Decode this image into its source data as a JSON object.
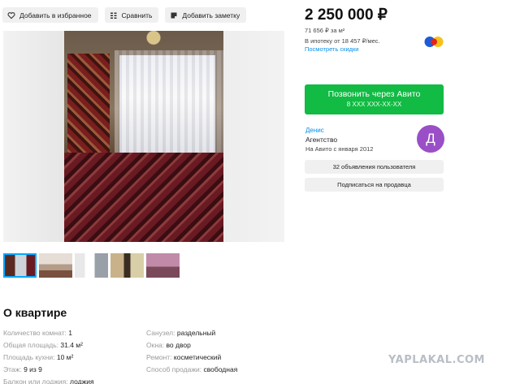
{
  "toolbar": {
    "favorites_label": "Добавить в избранное",
    "compare_label": "Сравнить",
    "note_label": "Добавить заметку",
    "icons": [
      "heart-icon",
      "compare-icon",
      "note-icon"
    ]
  },
  "thumbnails_count": 5,
  "about": {
    "title": "О квартире",
    "left": [
      {
        "key": "Количество комнат:",
        "value": "1"
      },
      {
        "key": "Общая площадь:",
        "value": "31.4 м²"
      },
      {
        "key": "Площадь кухни:",
        "value": "10 м²"
      },
      {
        "key": "Этаж:",
        "value": "9 из 9"
      },
      {
        "key": "Балкон или лоджия:",
        "value": "лоджия"
      }
    ],
    "right": [
      {
        "key": "Санузел:",
        "value": "раздельный"
      },
      {
        "key": "Окна:",
        "value": "во двор"
      },
      {
        "key": "Ремонт:",
        "value": "косметический"
      },
      {
        "key": "Способ продажи:",
        "value": "свободная"
      }
    ]
  },
  "price": {
    "main": "2 250 000 ₽",
    "per_m": "71 656 ₽ за м²",
    "mortgage": "В ипотеку от 18 457 ₽/мес.",
    "discounts_link": "Посмотреть скидки"
  },
  "call": {
    "label": "Позвонить через Авито",
    "phone": "8 XXX XXX-XX-XX"
  },
  "seller": {
    "name": "Денис",
    "type": "Агентство",
    "since": "На Авито с января 2012",
    "avatar_letter": "Д",
    "avatar_color": "#9a4fc7",
    "listings_button": "32 объявления пользователя",
    "subscribe_button": "Подписаться на продавца"
  },
  "colors": {
    "accent_green": "#11bb44",
    "link_blue": "#0a8ee6"
  },
  "watermark": "YAPLAKAL.COM"
}
